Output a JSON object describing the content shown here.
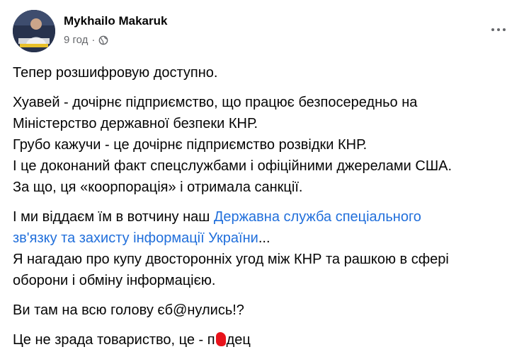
{
  "post": {
    "author": "Mykhailo Makaruk",
    "time": "9 год",
    "separator": "·",
    "privacy_icon": "globe-icon",
    "more_icon": "more-options-icon"
  },
  "content": {
    "p1": [
      "Тепер розшифровую доступно."
    ],
    "p2": [
      "Хуавей - дочірнє підприємство, що працює безпосередньо на",
      "Міністерство державної безпеки КНР.",
      "Грубо кажучи - це дочірнє підприємство розвідки КНР.",
      "І це доконаний факт спецслужбами і офіційними джерелами США.",
      "За що, ця «коорпорація» і отримала санкції."
    ],
    "p3": {
      "l1_text": "І ми віддаєм їм в вотчину наш ",
      "l1_link": "Державна служба спеціального",
      "l2_link": "зв'язку та захисту інформації України",
      "l2_text": "...",
      "l3": "Я нагадаю про купу двосторонніх угод між КНР та рашкою в сфері",
      "l4": "оборони і обміну інформацією."
    },
    "p4": [
      "Ви там на всю голову єб@нулись!?"
    ],
    "p5": {
      "before": "Це не зрада товариство, це - п",
      "after": "дец"
    }
  },
  "colors": {
    "link": "#216fdb",
    "meta": "#65676b",
    "censor_mark": "#e8131b"
  }
}
